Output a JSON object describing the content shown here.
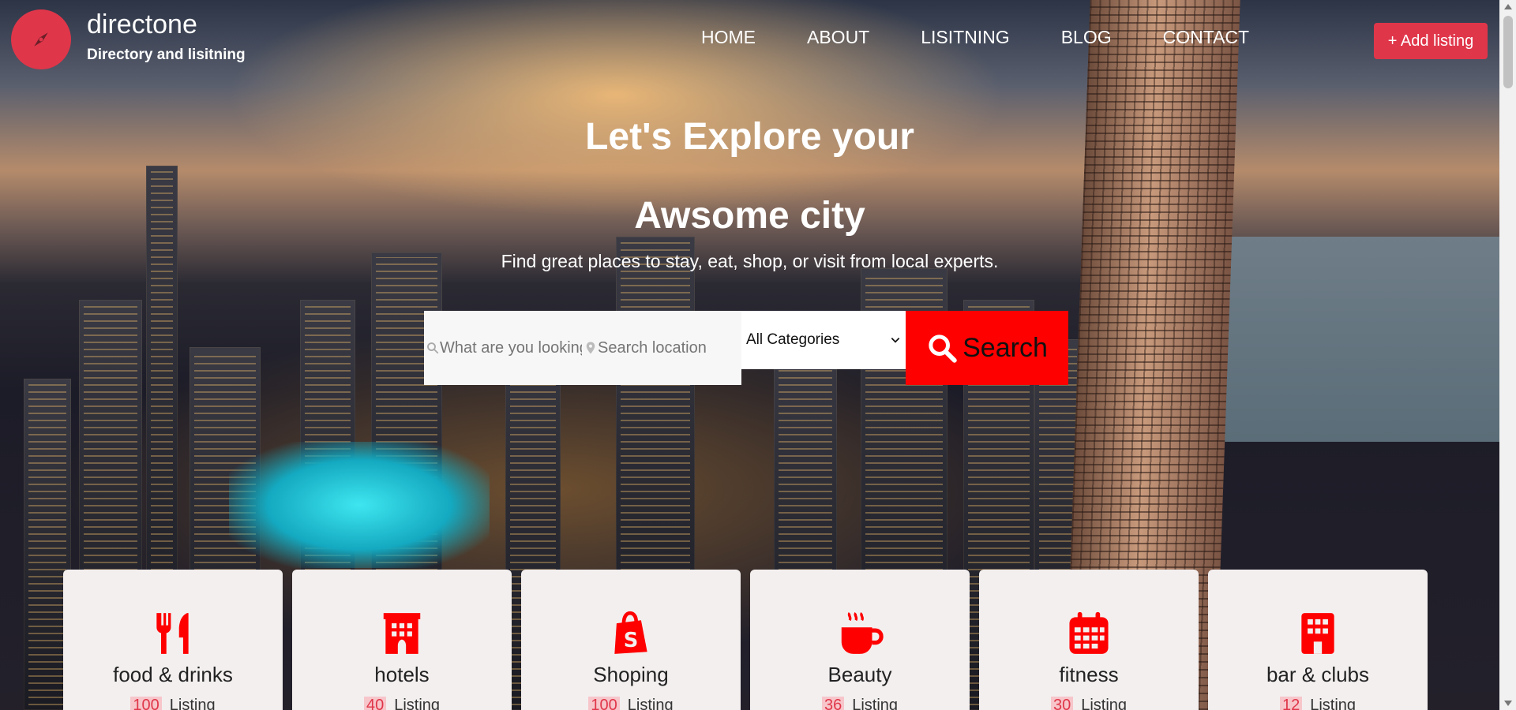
{
  "brand": {
    "title": "directone",
    "subtitle": "Directory and lisitning",
    "logo_icon": "compass-icon"
  },
  "nav": {
    "items": [
      "HOME",
      "ABOUT",
      "LISITNING",
      "BLOG",
      "CONTACT"
    ],
    "add_listing_label": "+ Add listing"
  },
  "hero": {
    "headline_1": "Let's Explore your",
    "headline_2": "Awsome city",
    "tagline": "Find great places to stay, eat, shop, or visit from local experts."
  },
  "search": {
    "keyword_placeholder": "What are you looking for",
    "location_placeholder": "Search location",
    "category_selected": "All Categories",
    "button_label": "Search"
  },
  "categories": [
    {
      "name": "food & drinks",
      "count": "100",
      "unit": "Listing",
      "icon": "utensils-icon"
    },
    {
      "name": "hotels",
      "count": "40",
      "unit": "Listing",
      "icon": "hotel-icon"
    },
    {
      "name": "Shoping",
      "count": "100",
      "unit": "Listing",
      "icon": "shopping-bag-icon"
    },
    {
      "name": "Beauty",
      "count": "36",
      "unit": "Listing",
      "icon": "coffee-cup-icon"
    },
    {
      "name": "fitness",
      "count": "30",
      "unit": "Listing",
      "icon": "calendar-icon"
    },
    {
      "name": "bar & clubs",
      "count": "12",
      "unit": "Listing",
      "icon": "building-icon"
    }
  ],
  "colors": {
    "accent": "#e0364a",
    "icon_red": "#ff0000",
    "card_bg": "#f3efef"
  }
}
